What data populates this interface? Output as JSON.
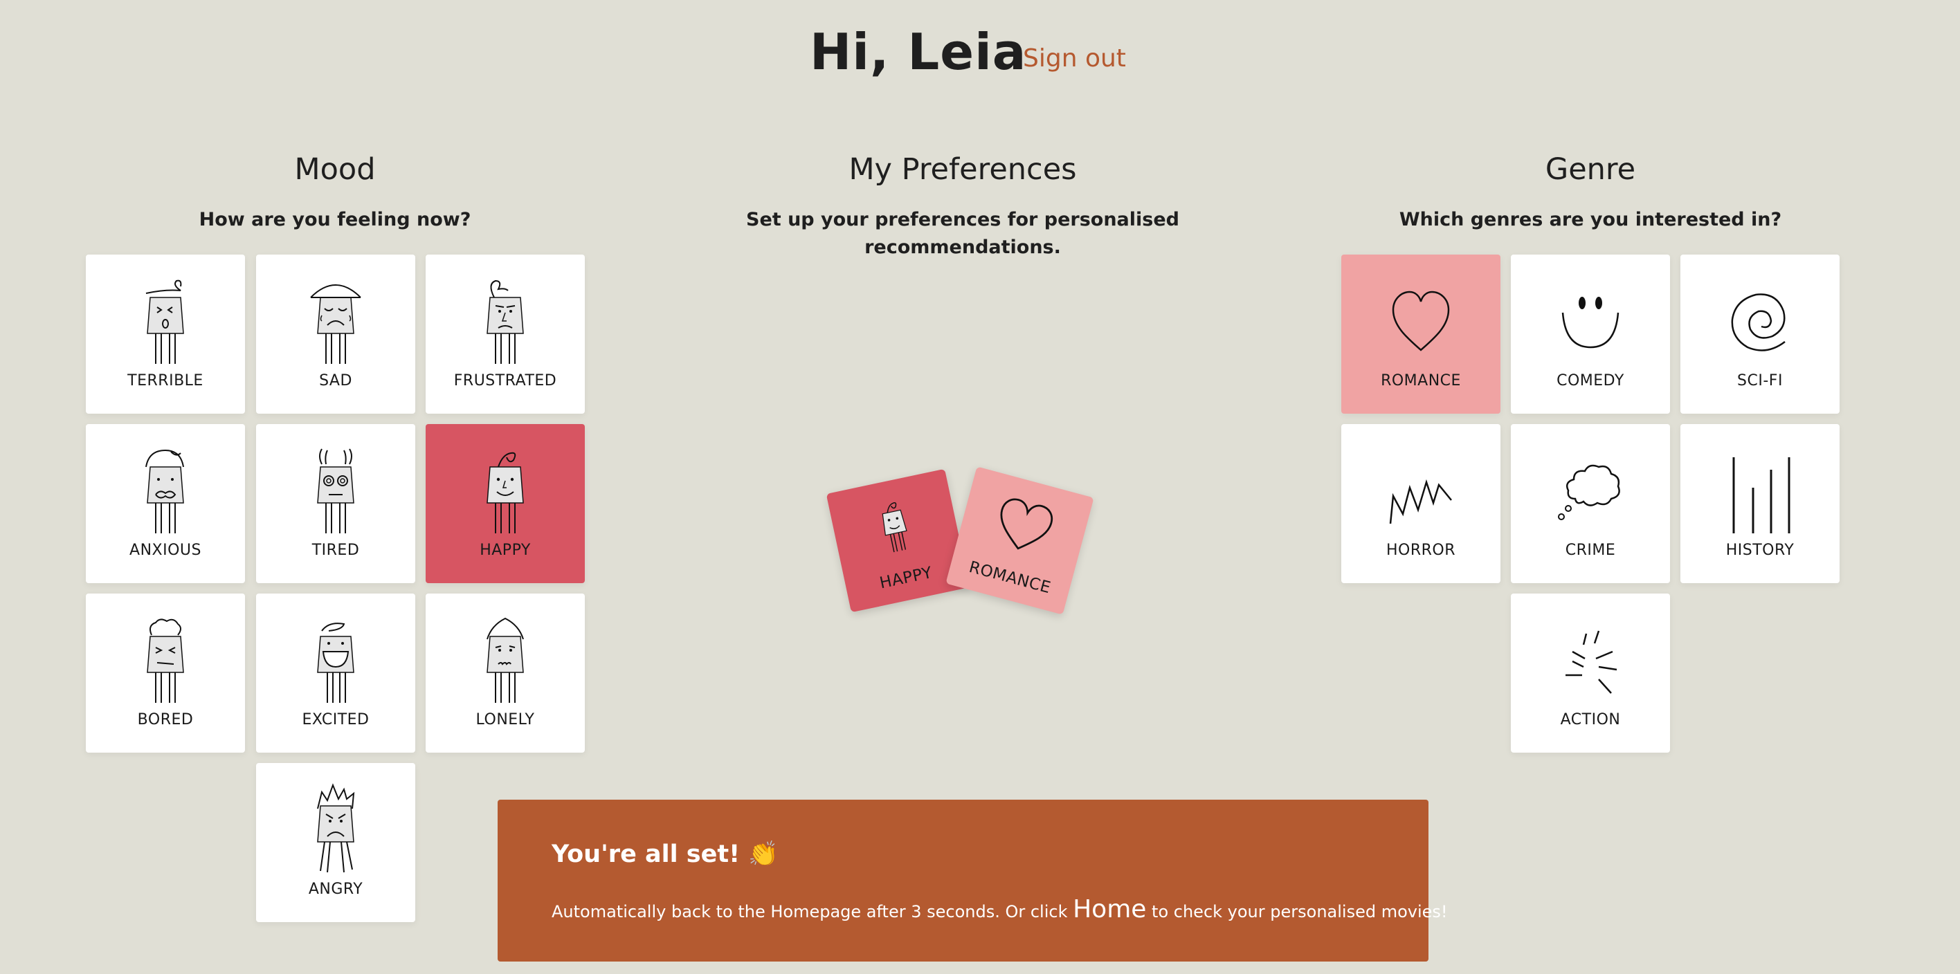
{
  "header": {
    "greeting": "Hi, Leia",
    "sign_out": "Sign out"
  },
  "mood": {
    "title": "Mood",
    "subtitle": "How are you feeling now?",
    "items": [
      {
        "label": "TERRIBLE"
      },
      {
        "label": "SAD"
      },
      {
        "label": "FRUSTRATED"
      },
      {
        "label": "ANXIOUS"
      },
      {
        "label": "TIRED"
      },
      {
        "label": "HAPPY"
      },
      {
        "label": "BORED"
      },
      {
        "label": "EXCITED"
      },
      {
        "label": "LONELY"
      },
      {
        "label": "ANGRY"
      }
    ],
    "selected": "HAPPY"
  },
  "preferences": {
    "title": "My Preferences",
    "subtitle": "Set up your preferences for personalised recommendations.",
    "chosen": [
      {
        "label": "HAPPY"
      },
      {
        "label": "ROMANCE"
      }
    ]
  },
  "genre": {
    "title": "Genre",
    "subtitle": "Which genres are you interested in?",
    "items": [
      {
        "label": "ROMANCE"
      },
      {
        "label": "COMEDY"
      },
      {
        "label": "SCI-FI"
      },
      {
        "label": "HORROR"
      },
      {
        "label": "CRIME"
      },
      {
        "label": "HISTORY"
      },
      {
        "label": "ACTION"
      }
    ],
    "selected": "ROMANCE"
  },
  "banner": {
    "title": "You're all set! 👏",
    "message_before": "Automatically back to the Homepage after 3 seconds. Or click ",
    "home_link": "Home",
    "message_after": " to check your personalised movies!"
  },
  "colors": {
    "background": "#e0dfd5",
    "accent": "#b45a30",
    "mood_selected": "#d75562",
    "genre_selected": "#f0a3a3"
  }
}
